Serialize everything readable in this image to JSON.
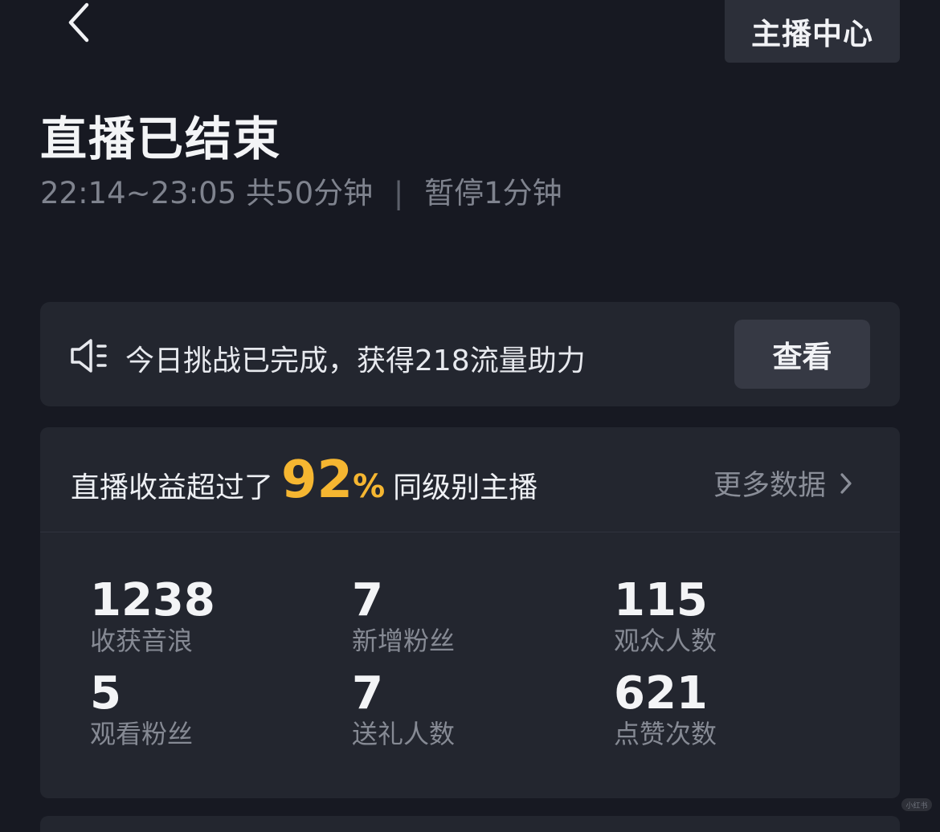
{
  "header": {
    "back_icon": "chevron-left-icon",
    "host_center_label": "主播中心"
  },
  "summary": {
    "title": "直播已结束",
    "time_range": "22:14~23:05",
    "total": "共50分钟",
    "separator": "|",
    "paused": "暂停1分钟"
  },
  "challenge": {
    "icon": "speaker-icon",
    "text": "今日挑战已完成，获得218流量助力",
    "view_label": "查看"
  },
  "income": {
    "prefix": "直播收益超过了",
    "percent": "92",
    "percent_sign": "%",
    "suffix": "同级别主播",
    "more_label": "更多数据",
    "accent_color": "#f5b631"
  },
  "stats": [
    {
      "value": "1238",
      "label": "收获音浪"
    },
    {
      "value": "7",
      "label": "新增粉丝"
    },
    {
      "value": "115",
      "label": "观众人数"
    },
    {
      "value": "5",
      "label": "观看粉丝"
    },
    {
      "value": "7",
      "label": "送礼人数"
    },
    {
      "value": "621",
      "label": "点赞次数"
    }
  ],
  "watermark": "小红书"
}
